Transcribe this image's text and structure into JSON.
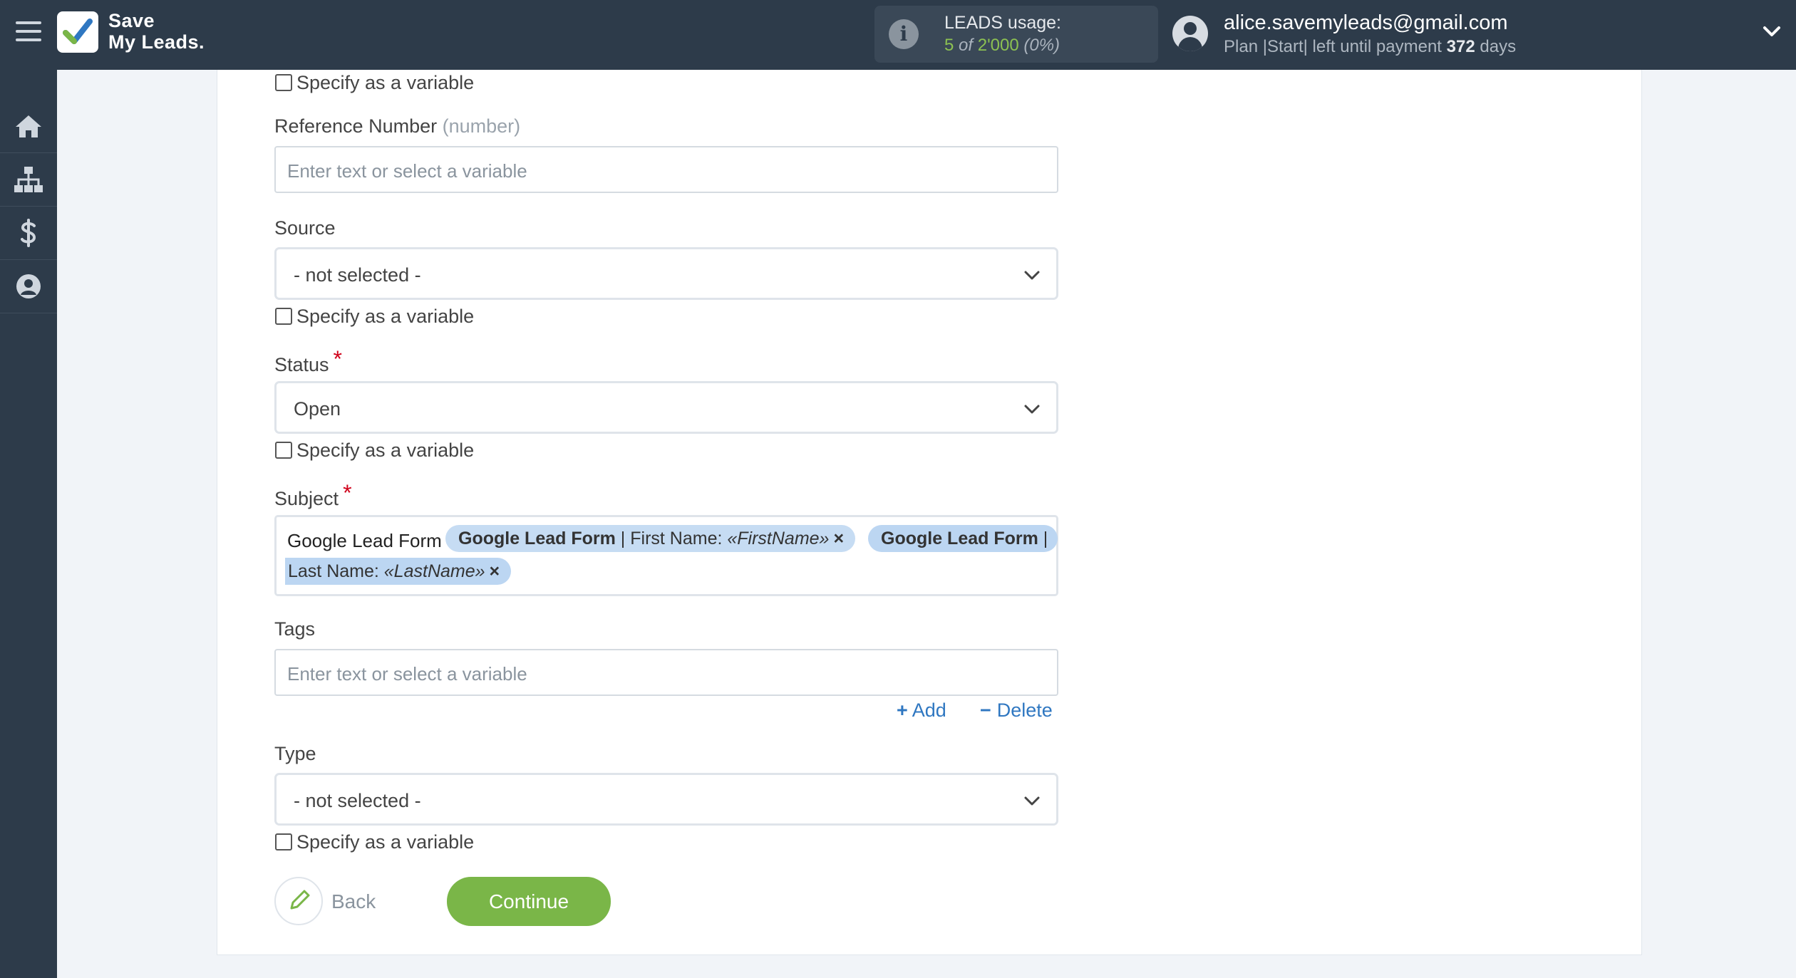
{
  "brand": {
    "line1": "Save",
    "line2": "My Leads."
  },
  "usage": {
    "label": "LEADS usage:",
    "used": "5",
    "of_text": "of",
    "limit": "2'000",
    "percent": "(0%)"
  },
  "account": {
    "email": "alice.savemyleads@gmail.com",
    "plan_prefix": "Plan",
    "plan_name": "|Start|",
    "plan_middle": "left until payment",
    "days": "372",
    "days_suffix": "days"
  },
  "sidebar": {
    "items": [
      "home-icon",
      "sitemap-icon",
      "dollar-icon",
      "user-icon"
    ]
  },
  "form": {
    "specify_label": "Specify as a variable",
    "reference": {
      "label": "Reference Number",
      "hint": "(number)",
      "placeholder": "Enter text or select a variable"
    },
    "source": {
      "label": "Source",
      "value": "- not selected -"
    },
    "status": {
      "label": "Status",
      "required": "*",
      "value": "Open"
    },
    "subject": {
      "label": "Subject",
      "required": "*",
      "plain_text": "Google Lead Form",
      "tags": [
        {
          "source": "Google Lead Form",
          "sep": " | ",
          "field": "First Name: ",
          "var": "«FirstName»",
          "remove": "×"
        },
        {
          "source": "Google Lead Form",
          "sep": " |",
          "field": "Last Name: ",
          "var": "«LastName»",
          "remove": "×"
        }
      ]
    },
    "tags": {
      "label": "Tags",
      "placeholder": "Enter text or select a variable",
      "add": "Add",
      "delete": "Delete"
    },
    "type": {
      "label": "Type",
      "value": "- not selected -"
    },
    "back": "Back",
    "continue": "Continue"
  },
  "colors": {
    "topbar": "#2d3b4a",
    "accent_green": "#7ab648",
    "link_blue": "#2f77c1",
    "tag_bg": "#c6dcf3",
    "required_red": "#d0021b"
  }
}
